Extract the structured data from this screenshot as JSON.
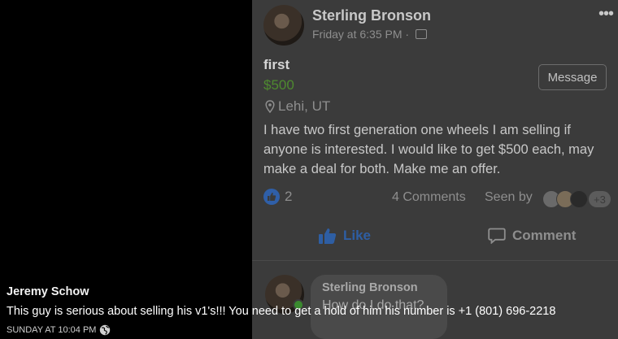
{
  "post": {
    "author": "Sterling Bronson",
    "time": "Friday at 6:35 PM",
    "time_separator": "·",
    "more_icon": "ellipsis-icon",
    "listing": {
      "title": "first",
      "price": "$500",
      "location": "Lehi, UT",
      "price_color": "#4e8a2f"
    },
    "message_button": "Message",
    "body": "I have two first generation one wheels I am selling if anyone is interested. I would like to get $500 each, may make a deal for both. Make me an offer.",
    "reactions_count": "2",
    "comments_count": "4 Comments",
    "seen_by_label": "Seen by",
    "seen_by_more": "+3",
    "like_label": "Like",
    "comment_label": "Comment",
    "accent_color": "#2e5ea3"
  },
  "comment": {
    "author": "Sterling Bronson",
    "text": "How do I do that?"
  },
  "overlay_comment": {
    "author": "Jeremy Schow",
    "text": "This guy is serious about selling his v1's!!! You need to get a hold of him his number is +1 (801) 696-2218",
    "time": "SUNDAY AT 10:04 PM",
    "icon": "globe-icon"
  }
}
